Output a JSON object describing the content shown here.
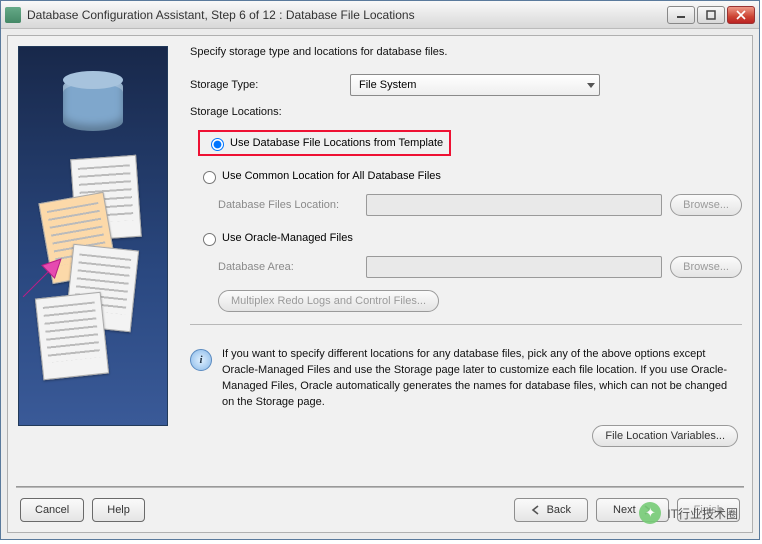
{
  "window": {
    "title": "Database Configuration Assistant, Step 6 of 12 : Database File Locations"
  },
  "main": {
    "description": "Specify storage type and locations for database files.",
    "storage_type_label": "Storage Type:",
    "storage_type_value": "File System",
    "storage_locations_label": "Storage Locations:",
    "radio_template": "Use Database File Locations from Template",
    "radio_common": "Use Common Location for All Database Files",
    "db_files_location_label": "Database Files Location:",
    "db_files_location_value": "",
    "radio_omf": "Use Oracle-Managed Files",
    "db_area_label": "Database Area:",
    "db_area_value": "",
    "browse_label": "Browse...",
    "multiplex_label": "Multiplex Redo Logs and Control Files...",
    "info_text": "If you want to specify different locations for any database files, pick any of the above options except Oracle-Managed Files and use the Storage page later to customize each file location. If you use Oracle-Managed Files, Oracle automatically generates the names for database files, which can not be changed on the Storage page.",
    "file_loc_vars_label": "File Location Variables..."
  },
  "buttons": {
    "cancel": "Cancel",
    "help": "Help",
    "back": "Back",
    "next": "Next",
    "finish": "Finish"
  },
  "watermark": {
    "text": "IT行业技术圈"
  }
}
